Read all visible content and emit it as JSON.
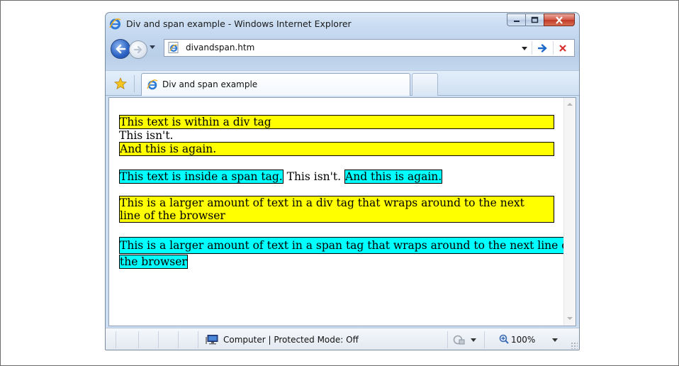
{
  "window": {
    "title": "Div and span example - Windows Internet Explorer"
  },
  "address_bar": {
    "url": "divandspan.htm"
  },
  "tab": {
    "label": "Div and span example"
  },
  "page": {
    "div1": "This text is within a div tag",
    "plain1": "This isn't.",
    "div2": "And this is again.",
    "span1": "This text is inside a span tag.",
    "plain2": " This isn't. ",
    "span2": "And this is again.",
    "div3": "This is a larger amount of text in a div tag that wraps around to the next line of the browser",
    "span3_line1": "This is a larger amount of text in a span tag that wraps around to the next line of",
    "span3_line2": "the browser"
  },
  "statusbar": {
    "zone": "Computer | Protected Mode: Off",
    "zoom": "100%"
  },
  "colors": {
    "div_background": "#ffff00",
    "span_background": "#00ffff"
  },
  "icons": [
    "ie-logo-icon",
    "back-arrow-icon",
    "forward-arrow-icon",
    "go-arrow-icon",
    "stop-x-icon",
    "favorites-star-icon",
    "computer-zone-icon",
    "security-icon",
    "zoom-icon"
  ]
}
